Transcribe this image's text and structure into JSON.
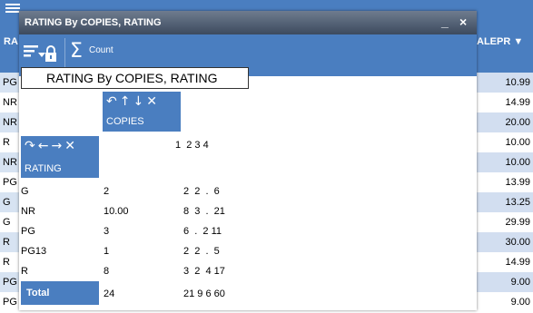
{
  "background_table": {
    "left_header": "RA",
    "right_header": "ALEPR ▼",
    "left_column": [
      "PG",
      "NR",
      "NR",
      "R",
      "NR",
      "PG",
      "G",
      "G",
      "R",
      "R",
      "PG",
      "PG"
    ],
    "right_column": [
      "10.99",
      "14.99",
      "20.00",
      "10.00",
      "10.00",
      "13.99",
      "13.25",
      "29.99",
      "30.00",
      "14.99",
      "9.00",
      "9.00"
    ]
  },
  "dialog": {
    "title": "RATING By COPIES, RATING",
    "minimize_glyph": "_",
    "close_glyph": "×"
  },
  "toolbar": {
    "count_label": "Count",
    "sigma_glyph": "Σ"
  },
  "pivot": {
    "title": "RATING By COPIES, RATING",
    "column_field": {
      "label": "COPIES",
      "controls": [
        "↶",
        "↑",
        "↓",
        "✕"
      ]
    },
    "row_field": {
      "label": "RATING",
      "controls": [
        "↷",
        "←",
        "→",
        "✕"
      ]
    },
    "column_headers": "1  2 3 4",
    "rows": [
      {
        "label": "G",
        "value": "2",
        "cells": "2  2  .  6"
      },
      {
        "label": "NR",
        "value": "10.00",
        "cells": "8  3  .  21"
      },
      {
        "label": "PG",
        "value": "3",
        "cells": "6  .  2 11"
      },
      {
        "label": "PG13",
        "value": "1",
        "cells": "2  2  .  5"
      },
      {
        "label": "R",
        "value": "8",
        "cells": "3  2  4 17"
      }
    ],
    "total": {
      "label": "Total",
      "value": "24",
      "cells": "21 9 6 60"
    }
  },
  "colors": {
    "accent_blue": "#4a7ec0",
    "titlebar": "#4f5d72",
    "row_stripe": "#d7e3f2"
  }
}
